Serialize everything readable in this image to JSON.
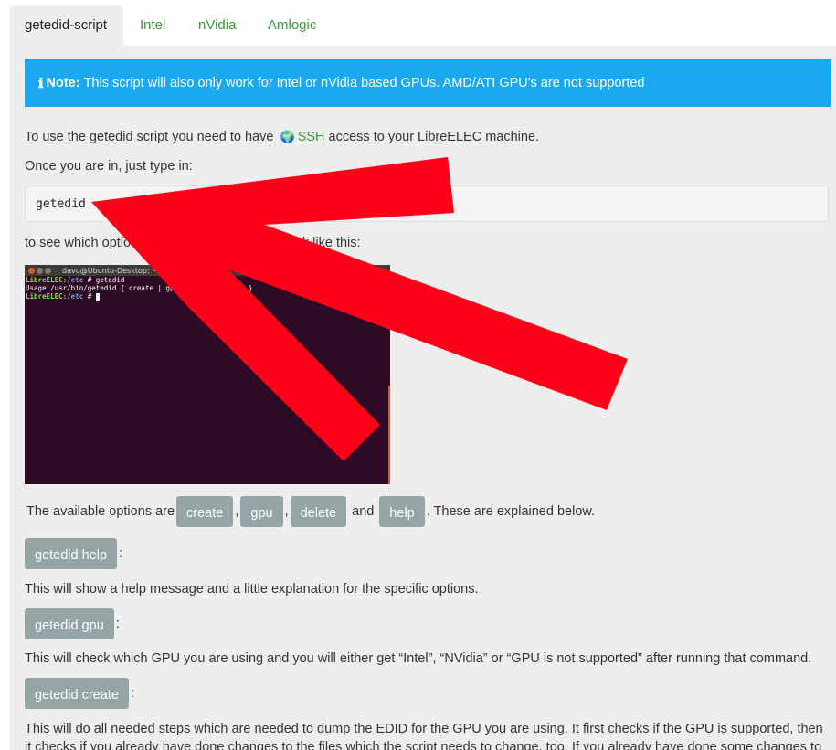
{
  "tabs": [
    "getedid-script",
    "Intel",
    "nVidia",
    "Amlogic"
  ],
  "note": {
    "icon": "info-icon",
    "label": "Note:",
    "text": "This script will also only work for Intel or nVidia based GPUs. AMD/ATI GPU's are not supported"
  },
  "intro": {
    "before": "To use the getedid script you need to have",
    "link": "SSH",
    "after": "access to your LibreELEC machine."
  },
  "once_in": "Once you are in, just type in:",
  "code": "getedid",
  "see_options": "to see which options are available. It should look like this:",
  "terminal": {
    "title": "davu@Ubuntu-Desktop: ~",
    "line1_prompt": "LibreELEC:",
    "line1_path": "/etc",
    "line1_cmd": " # getedid",
    "line2": "Usage /usr/bin/getedid { create | gpu | delete | help }",
    "line3_prompt": "LibreELEC:",
    "line3_path": "/etc",
    "line3_cmd": " # "
  },
  "options": {
    "before": "The available options are",
    "items": [
      "create",
      "gpu",
      "delete",
      "help"
    ],
    "comma": ",",
    "and": "and",
    "after": ". These are explained below."
  },
  "sections": [
    {
      "button": "getedid help",
      "colon": ":",
      "text": "This will show a help message and a little explanation for the specific options."
    },
    {
      "button": "getedid gpu",
      "colon": ":",
      "text": "This will check which GPU you are using and you will either get “Intel”, “NVidia” or “GPU is not supported” after running that command."
    },
    {
      "button": "getedid create",
      "colon": ":",
      "text": "This will do all needed steps which are needed to dump the EDID for the GPU you are using. It first checks if the GPU is supported, then"
    }
  ],
  "last_line_partial": "it checks if you already have done changes to the files which the script needs to change, too. If you already have done some changes to",
  "colors": {
    "tab_link": "#3a9b3a",
    "note_bg": "#1aa9f1",
    "panel_bg": "#eeeeee",
    "button_bg": "#95a5a6",
    "arrow": "#ff0019",
    "terminal_bg": "#2f0a24"
  }
}
